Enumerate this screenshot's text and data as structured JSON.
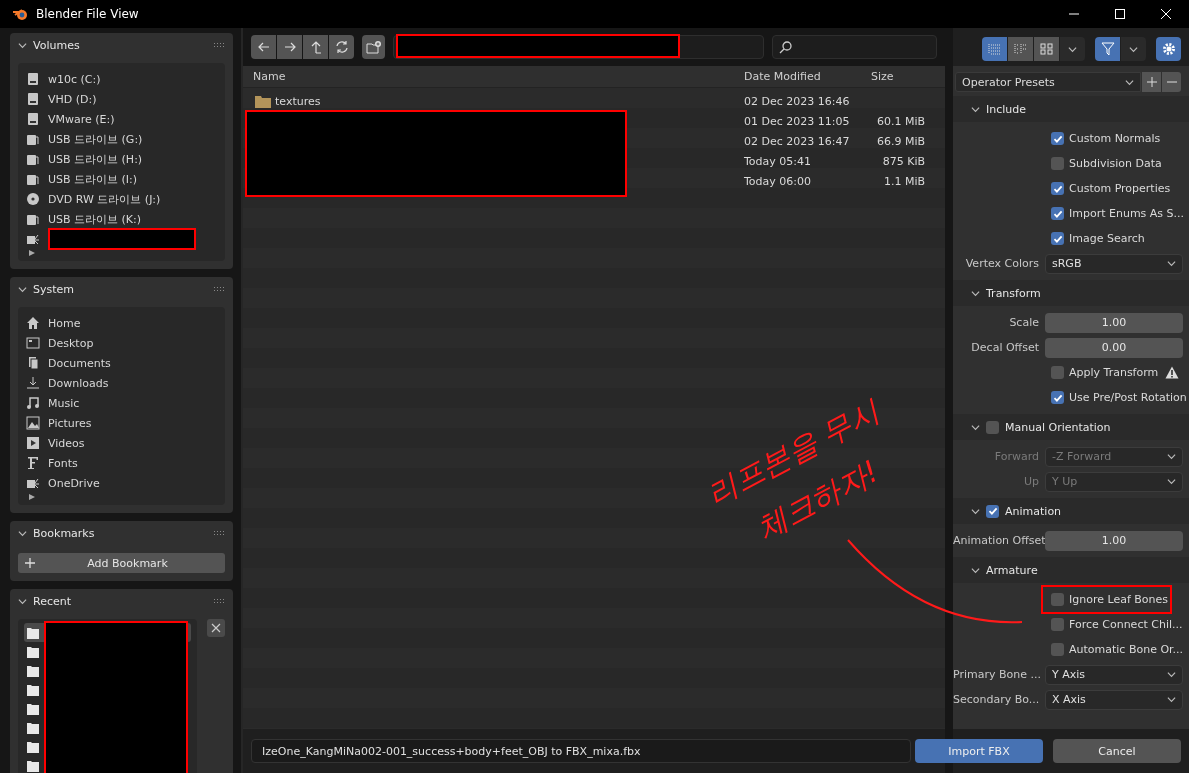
{
  "window": {
    "title": "Blender File View"
  },
  "sidebar": [
    {
      "title": "Volumes",
      "kind": "list",
      "items": [
        {
          "label": "w10c (C:)",
          "kind": "disk"
        },
        {
          "label": "VHD (D:)",
          "kind": "disk"
        },
        {
          "label": "VMware (E:)",
          "kind": "disk"
        },
        {
          "label": "USB 드라이브 (G:)",
          "kind": "usb"
        },
        {
          "label": "USB 드라이브 (H:)",
          "kind": "usb"
        },
        {
          "label": "USB 드라이브 (I:)",
          "kind": "usb"
        },
        {
          "label": "DVD RW 드라이브 (J:)",
          "kind": "dvd"
        },
        {
          "label": "USB 드라이브 (K:)",
          "kind": "usb"
        },
        {
          "kind": "network"
        }
      ]
    },
    {
      "title": "System",
      "kind": "list",
      "items": [
        {
          "label": "Home",
          "kind": "home"
        },
        {
          "label": "Desktop",
          "kind": "desktop"
        },
        {
          "label": "Documents",
          "kind": "documents"
        },
        {
          "label": "Downloads",
          "kind": "downloads"
        },
        {
          "label": "Music",
          "kind": "music"
        },
        {
          "label": "Pictures",
          "kind": "pictures"
        },
        {
          "label": "Videos",
          "kind": "videos"
        },
        {
          "label": "Fonts",
          "kind": "fonts"
        },
        {
          "label": "OneDrive",
          "kind": "network"
        }
      ]
    },
    {
      "title": "Bookmarks",
      "kind": "button",
      "button": "Add Bookmark"
    },
    {
      "title": "Recent",
      "kind": "recent",
      "items": [
        {
          "selected": true
        },
        {
          "selected": false
        },
        {
          "selected": false
        },
        {
          "selected": false
        },
        {
          "selected": false
        },
        {
          "selected": false
        },
        {
          "selected": false
        },
        {
          "selected": false
        }
      ]
    }
  ],
  "toolbar": {
    "view_modes": [
      {
        "kind": "list",
        "selected": true
      },
      {
        "kind": "columns",
        "selected": false
      },
      {
        "kind": "thumbnails",
        "selected": false
      }
    ],
    "filter_on": true
  },
  "file_list": {
    "columns": [
      "Name",
      "Date Modified",
      "Size"
    ],
    "rows": [
      {
        "kind": "folder",
        "name": "textures",
        "date": "02 Dec 2023 16:46"
      },
      {
        "kind": "file",
        "date": "01 Dec 2023 11:05",
        "size": "60.1 MiB"
      },
      {
        "kind": "file",
        "date": "02 Dec 2023 16:47",
        "size": "66.9 MiB"
      },
      {
        "kind": "file",
        "date": "Today 05:41",
        "size": "875 KiB"
      },
      {
        "kind": "file",
        "date": "Today 06:00",
        "size": "1.1 MiB"
      }
    ]
  },
  "settings": {
    "presets": "Operator Presets",
    "sections": [
      {
        "title": "Include",
        "rows": [
          {
            "kind": "check",
            "label": "Custom Normals",
            "checked": true
          },
          {
            "kind": "check",
            "label": "Subdivision Data",
            "checked": false
          },
          {
            "kind": "check",
            "label": "Custom Properties",
            "checked": true
          },
          {
            "kind": "check",
            "label": "Import Enums As S...",
            "checked": true
          },
          {
            "kind": "check",
            "label": "Image Search",
            "checked": true
          },
          {
            "kind": "select",
            "label": "Vertex Colors",
            "value": "sRGB"
          }
        ]
      },
      {
        "title": "Transform",
        "rows": [
          {
            "kind": "number",
            "label": "Scale",
            "value": "1.00"
          },
          {
            "kind": "number",
            "label": "Decal Offset",
            "value": "0.00"
          },
          {
            "kind": "check",
            "label": "Apply Transform",
            "checked": false,
            "warning": true
          },
          {
            "kind": "check",
            "label": "Use Pre/Post Rotation",
            "checked": true
          }
        ]
      },
      {
        "title": "Manual Orientation",
        "checked": false,
        "rows": [
          {
            "kind": "select",
            "label": "Forward",
            "value": "-Z Forward",
            "disabled": true
          },
          {
            "kind": "select",
            "label": "Up",
            "value": "Y Up",
            "disabled": true
          }
        ]
      },
      {
        "title": "Animation",
        "checked": true,
        "rows": [
          {
            "kind": "number",
            "label": "Animation Offset",
            "value": "1.00"
          }
        ]
      },
      {
        "title": "Armature",
        "rows": [
          {
            "kind": "check",
            "label": "Ignore Leaf Bones",
            "checked": false,
            "highlighted": true
          },
          {
            "kind": "check",
            "label": "Force Connect Chil...",
            "checked": false
          },
          {
            "kind": "check",
            "label": "Automatic Bone Or...",
            "checked": false
          },
          {
            "kind": "select",
            "label": "Primary Bone ...",
            "value": "Y Axis"
          },
          {
            "kind": "select",
            "label": "Secondary Bo...",
            "value": "X Axis"
          }
        ]
      }
    ]
  },
  "footer": {
    "filename": "IzeOne_KangMiNa002-001_success+body+feet_OBJ to FBX_mixa.fbx",
    "buttons": [
      {
        "label": "Import FBX",
        "kind": "primary"
      },
      {
        "label": "Cancel",
        "kind": "normal"
      }
    ]
  },
  "annotation": {
    "lines": [
      "리프본을 무시",
      "체크하자!"
    ]
  }
}
